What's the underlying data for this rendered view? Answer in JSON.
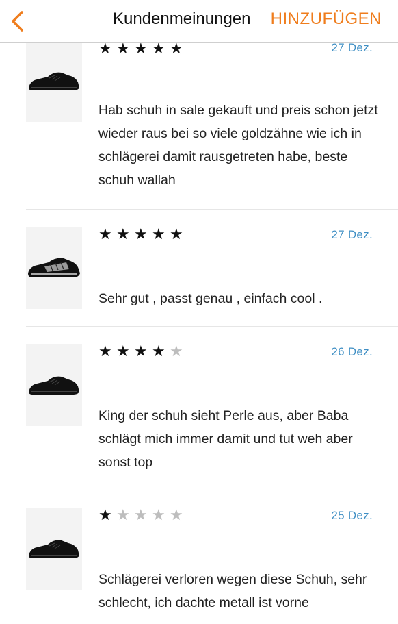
{
  "header": {
    "title": "Kundenmeinungen",
    "action_label": "HINZUFÜGEN",
    "accent": "#ef7d1d"
  },
  "reviews": [
    {
      "rating": 5,
      "date": "27 Dez.",
      "text": "Hab schuh in sale gekauft und preis schon jetzt wieder raus bei so viele goldzähne wie ich in schlägerei damit rausgetreten habe, beste schuh wallah"
    },
    {
      "rating": 5,
      "date": "27 Dez.",
      "text": "Sehr gut , passt genau , einfach cool ."
    },
    {
      "rating": 4,
      "date": "26 Dez.",
      "text": "King der schuh sieht Perle aus, aber Baba schlägt mich immer damit und tut weh aber sonst top"
    },
    {
      "rating": 1,
      "date": "25 Dez.",
      "text": "Schlägerei verloren wegen diese Schuh, sehr schlecht, ich dachte metall ist vorne"
    }
  ],
  "colors": {
    "date": "#3f8fc4",
    "star_on": "#111111",
    "star_off": "#bdbdbd"
  }
}
